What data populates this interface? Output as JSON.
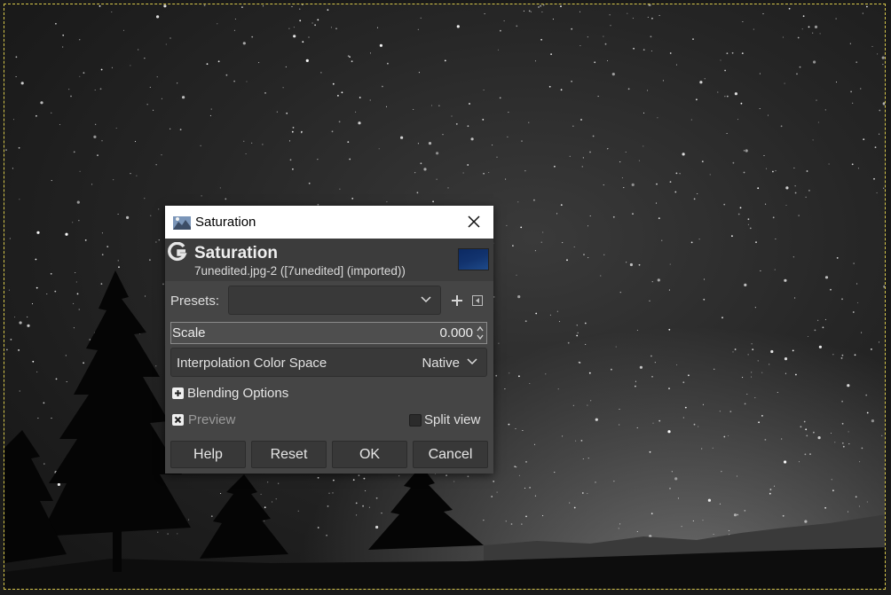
{
  "dialog": {
    "window_title": "Saturation",
    "header_title": "Saturation",
    "header_subtitle": "7unedited.jpg-2 ([7unedited] (imported))",
    "presets_label": "Presets:",
    "presets_value": "",
    "scale_label": "Scale",
    "scale_value": "0.000",
    "interp_label": "Interpolation Color Space",
    "interp_value": "Native",
    "blending_label": "Blending Options",
    "preview_label": "Preview",
    "preview_checked": true,
    "split_label": "Split view",
    "split_checked": false,
    "buttons": {
      "help": "Help",
      "reset": "Reset",
      "ok": "OK",
      "cancel": "Cancel"
    }
  },
  "colors": {
    "selection_outline": "#d8c84a",
    "dialog_bg": "#454545",
    "titlebar_bg": "#ffffff",
    "thumbnail": "#12336e"
  },
  "icons": {
    "app": "gimp-app-icon",
    "logo": "gimp-logo-icon",
    "close": "close-icon",
    "add": "plus-icon",
    "presets_menu": "menu-triangle-icon",
    "chevron": "chevron-down-icon",
    "expander": "expander-plus-icon",
    "checkbox": "checkbox-icon"
  }
}
